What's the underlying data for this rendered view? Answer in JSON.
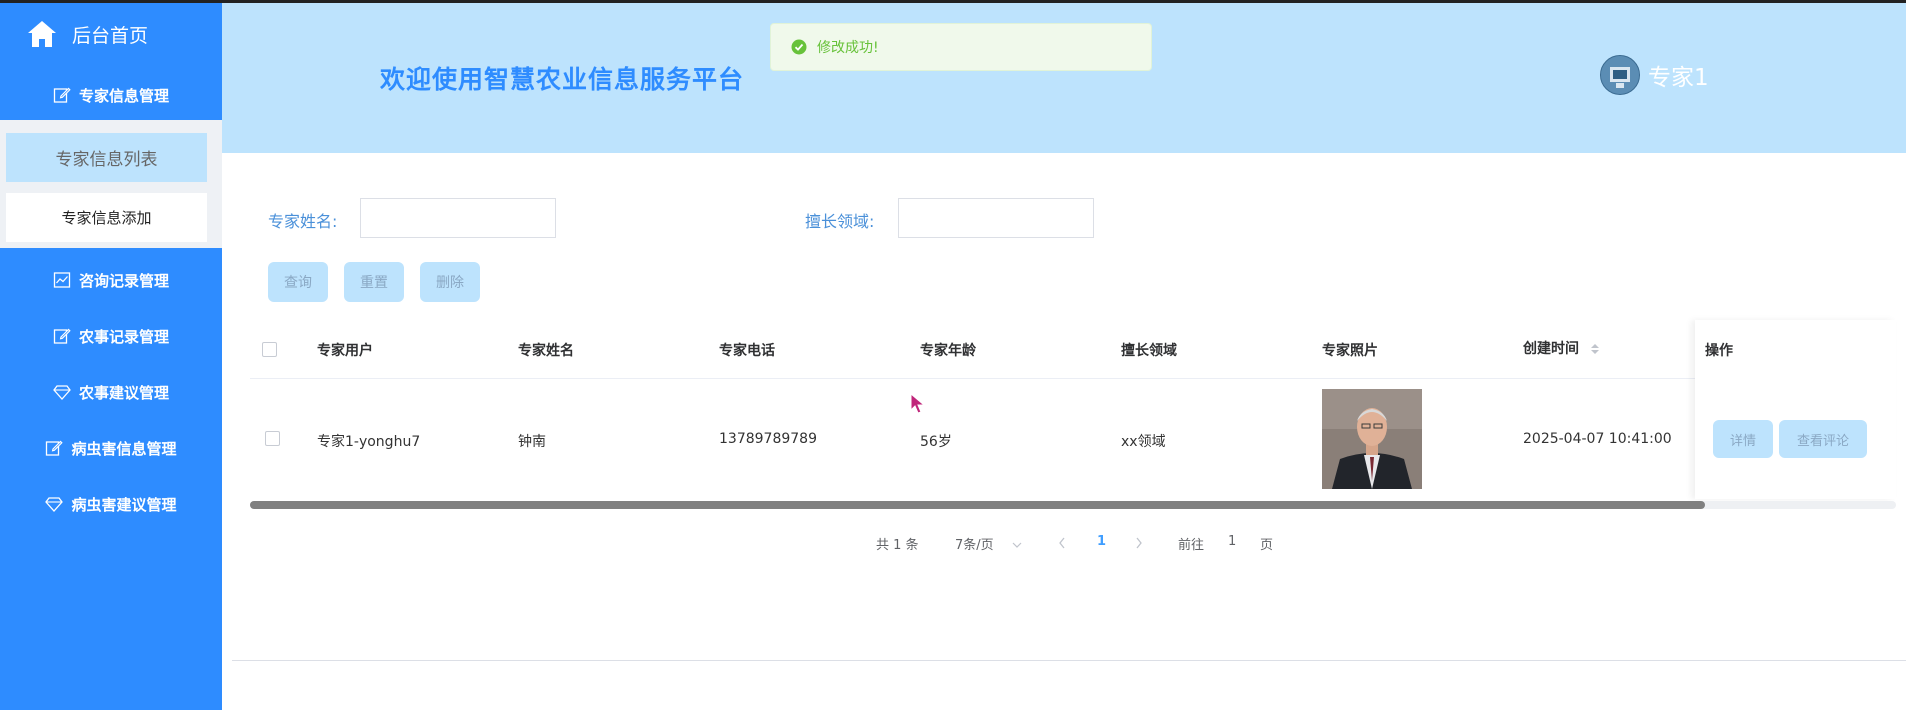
{
  "sidebar": {
    "home_label": "后台首页",
    "menus": [
      {
        "label": "专家信息管理",
        "icon": "edit-icon"
      },
      {
        "label": "咨询记录管理",
        "icon": "chart-icon"
      },
      {
        "label": "农事记录管理",
        "icon": "edit-icon"
      },
      {
        "label": "农事建议管理",
        "icon": "diamond-icon"
      },
      {
        "label": "病虫害信息管理",
        "icon": "edit-icon"
      },
      {
        "label": "病虫害建议管理",
        "icon": "diamond-icon"
      }
    ],
    "submenu": {
      "active": "专家信息列表",
      "other": "专家信息添加"
    }
  },
  "header": {
    "welcome": "欢迎使用智慧农业信息服务平台",
    "toast": "修改成功!",
    "username": "专家1"
  },
  "search": {
    "name_label": "专家姓名:",
    "name_value": "",
    "field_label": "擅长领域:",
    "field_value": "",
    "query_btn": "查询",
    "reset_btn": "重置",
    "delete_btn": "删除"
  },
  "table": {
    "columns": [
      "专家用户",
      "专家姓名",
      "专家电话",
      "专家年龄",
      "擅长领域",
      "专家照片",
      "创建时间",
      "操作"
    ],
    "rows": [
      {
        "user": "专家1-yonghu7",
        "name": "钟南",
        "phone": "13789789789",
        "age": "56岁",
        "field": "xx领域",
        "created": "2025-04-07 10:41:00",
        "detail_btn": "详情",
        "comment_btn": "查看评论"
      }
    ]
  },
  "pagination": {
    "total": "共 1 条",
    "page_size": "7条/页",
    "current": "1",
    "goto_prefix": "前往",
    "goto_value": "1",
    "goto_suffix": "页"
  },
  "colors": {
    "sidebar": "#2e8cff",
    "header": "#bde3fd",
    "accent": "#2e8cff",
    "success": "#67c23a"
  }
}
